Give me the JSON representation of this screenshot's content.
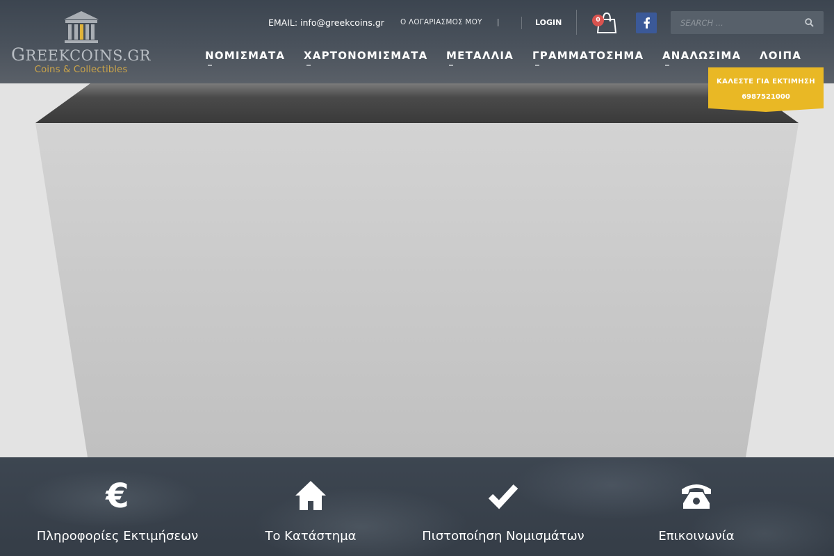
{
  "logo": {
    "brand_prefix": "G",
    "brand_rest": "REEKCOINS.GR",
    "tagline": "Coins & Collectibles"
  },
  "topbar": {
    "email": "EMAIL: info@greekcoins.gr",
    "account": "Ο ΛΟΓΑΡΙΑΣΜΟΣ ΜΟΥ",
    "separator": "|",
    "login": "LOGIN",
    "cart_count": "0"
  },
  "search": {
    "placeholder": "SEARCH ..."
  },
  "nav": {
    "items": [
      {
        "label": "ΝΟΜΙΣΜΑΤΑ"
      },
      {
        "label": "ΧΑΡΤΟΝΟΜΙΣΜΑΤΑ"
      },
      {
        "label": "ΜΕΤΑΛΛΙΑ"
      },
      {
        "label": "ΓΡΑΜΜΑΤΟΣΗΜΑ"
      },
      {
        "label": "ΑΝΑΛΩΣΙΜΑ"
      },
      {
        "label": "ΛΟΙΠΑ"
      }
    ]
  },
  "call_badge": {
    "line1": "ΚΑΛΕΣΤΕ ΓΙΑ ΕΚΤΙΜΗΣΗ",
    "line2": "6987521000"
  },
  "features": [
    {
      "icon": "euro-icon",
      "label": "Πληροφορίες Εκτιμήσεων"
    },
    {
      "icon": "home-icon",
      "label": "Το Κατάστημα"
    },
    {
      "icon": "checkmark-icon",
      "label": "Πιστοποίηση Νομισμάτων"
    },
    {
      "icon": "phone-icon",
      "label": "Επικοινωνία"
    }
  ],
  "colors": {
    "accent": "#e9b825",
    "header_bg": "#464e58",
    "facebook": "#3b5998",
    "cart_badge": "#d9534f",
    "logo_gold": "#c9a34a"
  }
}
